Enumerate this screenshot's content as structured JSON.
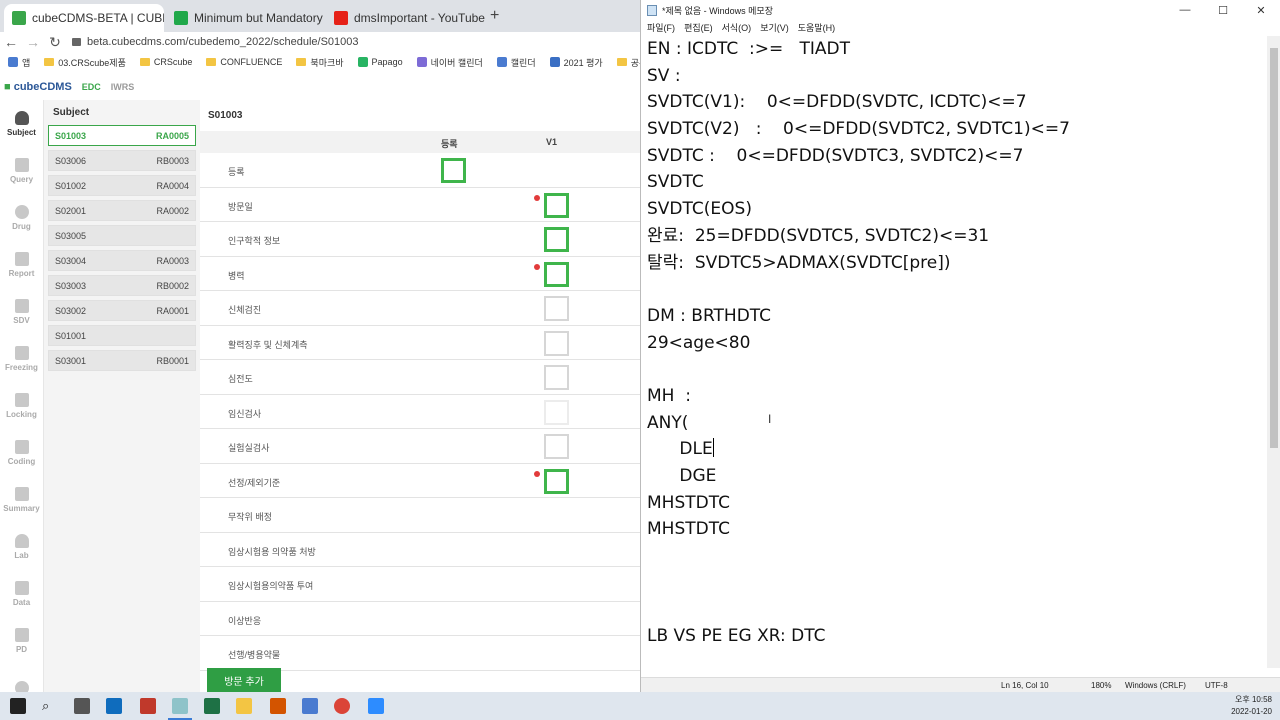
{
  "browser": {
    "tabs": [
      {
        "title": "cubeCDMS-BETA | CUBEDEMO_",
        "color": "#3aa64a"
      },
      {
        "title": "Minimum but Mandatory Requ",
        "color": "#20a84a"
      },
      {
        "title": "dmsImportant - YouTube",
        "color": "#e62117"
      }
    ],
    "url": "beta.cubecdms.com/cubedemo_2022/schedule/S01003",
    "bookmarks": [
      "앱",
      "03.CRScube제품",
      "CRScube",
      "CONFLUENCE",
      "북마크바",
      "Papago",
      "네이버 캘린더",
      "캘린더",
      "2021 평가",
      "공유DRIVE"
    ]
  },
  "app": {
    "logo": "cubeCDMS",
    "header_links": [
      "EDC",
      "IWRS"
    ],
    "nav": [
      "Subject",
      "Query",
      "Drug",
      "Report",
      "SDV",
      "Freezing",
      "Locking",
      "Coding",
      "Summary",
      "Lab",
      "Data",
      "PD",
      ""
    ],
    "subject_panel_title": "Subject",
    "subjects": [
      {
        "id": "S01003",
        "code": "RA0005",
        "active": true
      },
      {
        "id": "S03006",
        "code": "RB0003",
        "active": false
      },
      {
        "id": "S01002",
        "code": "RA0004",
        "active": false
      },
      {
        "id": "S02001",
        "code": "RA0002",
        "active": false
      },
      {
        "id": "S03005",
        "code": "",
        "active": false
      },
      {
        "id": "S03004",
        "code": "RA0003",
        "active": false
      },
      {
        "id": "S03003",
        "code": "RB0002",
        "active": false
      },
      {
        "id": "S03002",
        "code": "RA0001",
        "active": false
      },
      {
        "id": "S01001",
        "code": "",
        "active": false
      },
      {
        "id": "S03001",
        "code": "RB0001",
        "active": false
      }
    ],
    "schedule_title": "S01003",
    "columns": [
      "등록",
      "V1"
    ],
    "rows": [
      {
        "label": "등록",
        "col1": "green",
        "col2": "none",
        "dot": false
      },
      {
        "label": "방문일",
        "col1": "none",
        "col2": "green",
        "dot": true
      },
      {
        "label": "인구학적 정보",
        "col1": "none",
        "col2": "green",
        "dot": false
      },
      {
        "label": "병력",
        "col1": "none",
        "col2": "green",
        "dot": true
      },
      {
        "label": "신체검진",
        "col1": "none",
        "col2": "gray",
        "dot": false
      },
      {
        "label": "활력징후 및 신체계측",
        "col1": "none",
        "col2": "gray",
        "dot": false
      },
      {
        "label": "심전도",
        "col1": "none",
        "col2": "gray",
        "dot": false
      },
      {
        "label": "임신검사",
        "col1": "none",
        "col2": "faint",
        "dot": false
      },
      {
        "label": "실험실검사",
        "col1": "none",
        "col2": "gray",
        "dot": false
      },
      {
        "label": "선정/제외기준",
        "col1": "none",
        "col2": "green",
        "dot": true
      },
      {
        "label": "무작위 배정",
        "col1": "none",
        "col2": "none",
        "dot": false
      },
      {
        "label": "임상시험용 의약품 처방",
        "col1": "none",
        "col2": "none",
        "dot": false
      },
      {
        "label": "임상시험용의약품 투여",
        "col1": "none",
        "col2": "none",
        "dot": false
      },
      {
        "label": "이상반응",
        "col1": "none",
        "col2": "none",
        "dot": false
      },
      {
        "label": "선행/병용약물",
        "col1": "none",
        "col2": "none",
        "dot": false
      }
    ],
    "add_visit_label": "방문 추가"
  },
  "notepad": {
    "title": "*제목 없음 - Windows 메모장",
    "menu": [
      "파일(F)",
      "편집(E)",
      "서식(O)",
      "보기(V)",
      "도움말(H)"
    ],
    "lines": [
      "EN : ICDTC  :>=   TIADT",
      "SV :",
      "SVDTC(V1):    0<=DFDD(SVDTC, ICDTC)<=7",
      "SVDTC(V2)   :    0<=DFDD(SVDTC2, SVDTC1)<=7",
      "SVDTC :    0<=DFDD(SVDTC3, SVDTC2)<=7",
      "SVDTC",
      "SVDTC(EOS)",
      "완료:  25=DFDD(SVDTC5, SVDTC2)<=31",
      "탈락:  SVDTC5>ADMAX(SVDTC[pre])",
      "",
      "DM : BRTHDTC",
      "29<age<80",
      "",
      "MH  :",
      "ANY(",
      "      DLE",
      "      DGE",
      "MHSTDTC",
      "MHSTDTC",
      "",
      "",
      "",
      "LB VS PE EG XR: DTC"
    ],
    "status": {
      "position": "Ln 16, Col 10",
      "zoom": "180%",
      "eol": "Windows (CRLF)",
      "encoding": "UTF-8"
    }
  },
  "taskbar": {
    "time": "오후 10:58",
    "date": "2022-01-20"
  }
}
